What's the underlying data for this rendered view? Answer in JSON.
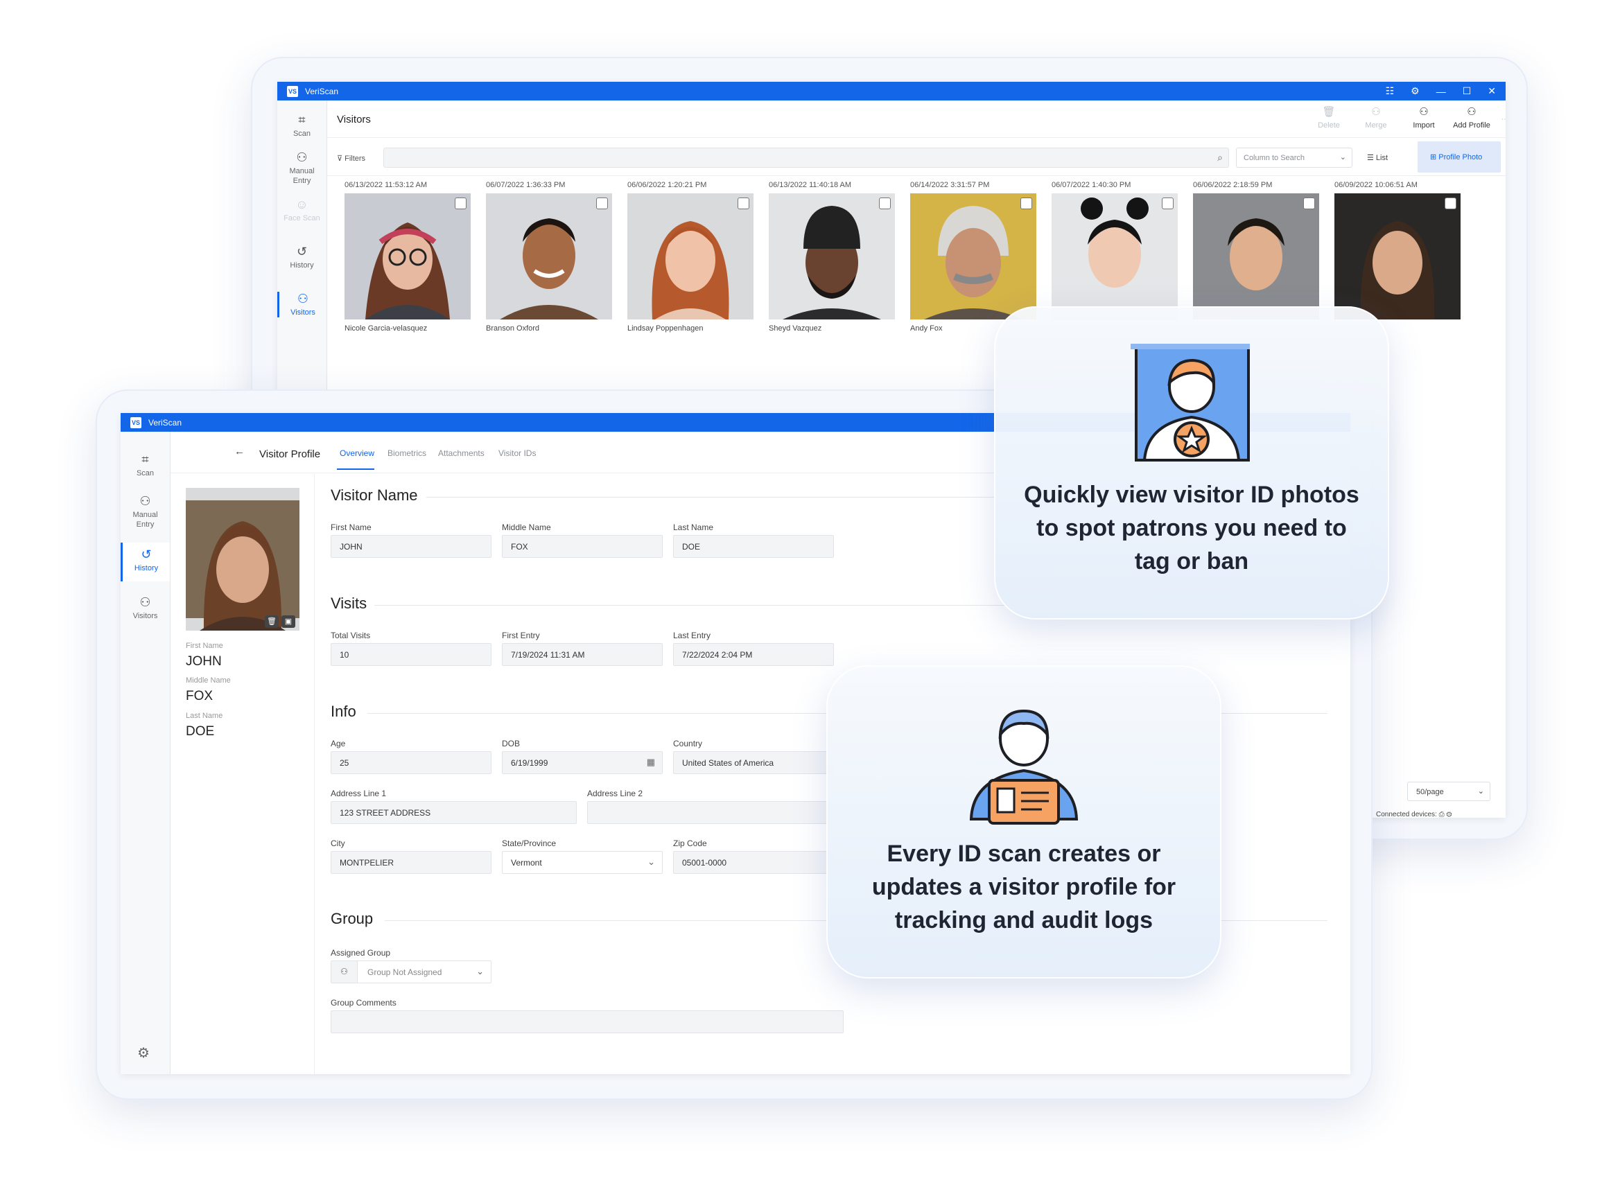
{
  "app": {
    "name": "VeriScan",
    "logo": "VS"
  },
  "window_controls": [
    "☷",
    "⚙",
    "—",
    "☐",
    "✕"
  ],
  "back_window": {
    "sidebar": [
      {
        "label": "Scan",
        "icon": "scan-icon",
        "glyph": "⌗"
      },
      {
        "label": "Manual Entry",
        "icon": "manual-entry-icon",
        "glyph": "⚇"
      },
      {
        "label": "Face Scan",
        "icon": "face-scan-icon",
        "glyph": "☺"
      },
      {
        "label": "History",
        "icon": "history-icon",
        "glyph": "↺"
      },
      {
        "label": "Visitors",
        "icon": "visitors-icon",
        "glyph": "⚇"
      }
    ],
    "title": "Visitors",
    "toolbar": {
      "delete": "Delete",
      "merge": "Merge",
      "import": "Import",
      "add_profile": "Add Profile",
      "more": "···"
    },
    "filters_label": "Filters",
    "column_search_placeholder": "Column to Search",
    "view_list": "List",
    "view_profile_photo": "Profile Photo",
    "visitors": [
      {
        "date": "06/13/2022 11:53:12 AM",
        "name": "Nicole Garcia-velasquez"
      },
      {
        "date": "06/07/2022 1:36:33 PM",
        "name": "Branson Oxford"
      },
      {
        "date": "06/06/2022 1:20:21 PM",
        "name": "Lindsay Poppenhagen"
      },
      {
        "date": "06/13/2022 11:40:18 AM",
        "name": "Sheyd Vazquez"
      },
      {
        "date": "06/14/2022 3:31:57 PM",
        "name": "Andy Fox"
      },
      {
        "date": "06/07/2022 1:40:30 PM",
        "name": ""
      },
      {
        "date": "06/06/2022 2:18:59 PM",
        "name": ""
      },
      {
        "date": "06/09/2022 10:06:51 AM",
        "name": ""
      }
    ],
    "page_size": "50/page",
    "connected_devices": "Connected devices:"
  },
  "front_window": {
    "sidebar": [
      {
        "label": "Scan",
        "glyph": "⌗"
      },
      {
        "label": "Manual Entry",
        "glyph": "⚇"
      },
      {
        "label": "History",
        "glyph": "↺"
      },
      {
        "label": "Visitors",
        "glyph": "⚇"
      }
    ],
    "page_title": "Visitor Profile",
    "tabs": [
      "Overview",
      "Biometrics",
      "Attachments",
      "Visitor IDs"
    ],
    "left": {
      "first_name_label": "First Name",
      "first_name": "JOHN",
      "middle_name_label": "Middle Name",
      "middle_name": "FOX",
      "last_name_label": "Last Name",
      "last_name": "DOE"
    },
    "sections": {
      "visitor_name": "Visitor Name",
      "visits": "Visits",
      "info": "Info",
      "group": "Group"
    },
    "fields": {
      "first_name": {
        "label": "First Name",
        "value": "JOHN"
      },
      "middle_name": {
        "label": "Middle Name",
        "value": "FOX"
      },
      "last_name": {
        "label": "Last Name",
        "value": "DOE"
      },
      "total_visits": {
        "label": "Total Visits",
        "value": "10"
      },
      "first_entry": {
        "label": "First Entry",
        "value": "7/19/2024 11:31 AM"
      },
      "last_entry": {
        "label": "Last Entry",
        "value": "7/22/2024 2:04 PM"
      },
      "age": {
        "label": "Age",
        "value": "25"
      },
      "dob": {
        "label": "DOB",
        "value": "6/19/1999"
      },
      "country": {
        "label": "Country",
        "value": "United States of America"
      },
      "address1": {
        "label": "Address Line 1",
        "value": "123 STREET ADDRESS"
      },
      "address2": {
        "label": "Address Line 2",
        "value": ""
      },
      "city": {
        "label": "City",
        "value": "MONTPELIER"
      },
      "state": {
        "label": "State/Province",
        "value": "Vermont"
      },
      "zip": {
        "label": "Zip Code",
        "value": "05001-0000"
      },
      "assigned_group": {
        "label": "Assigned Group",
        "value": "Group Not Assigned"
      },
      "group_comments": {
        "label": "Group Comments",
        "value": ""
      }
    }
  },
  "callouts": {
    "photos": "Quickly view visitor ID photos to spot patrons you need to tag or ban",
    "scan": "Every ID scan creates or updates a visitor profile for tracking and audit logs"
  },
  "colors": {
    "accent": "#1366e8",
    "callout_orange": "#f5a262",
    "callout_blue": "#8fb7f2"
  }
}
